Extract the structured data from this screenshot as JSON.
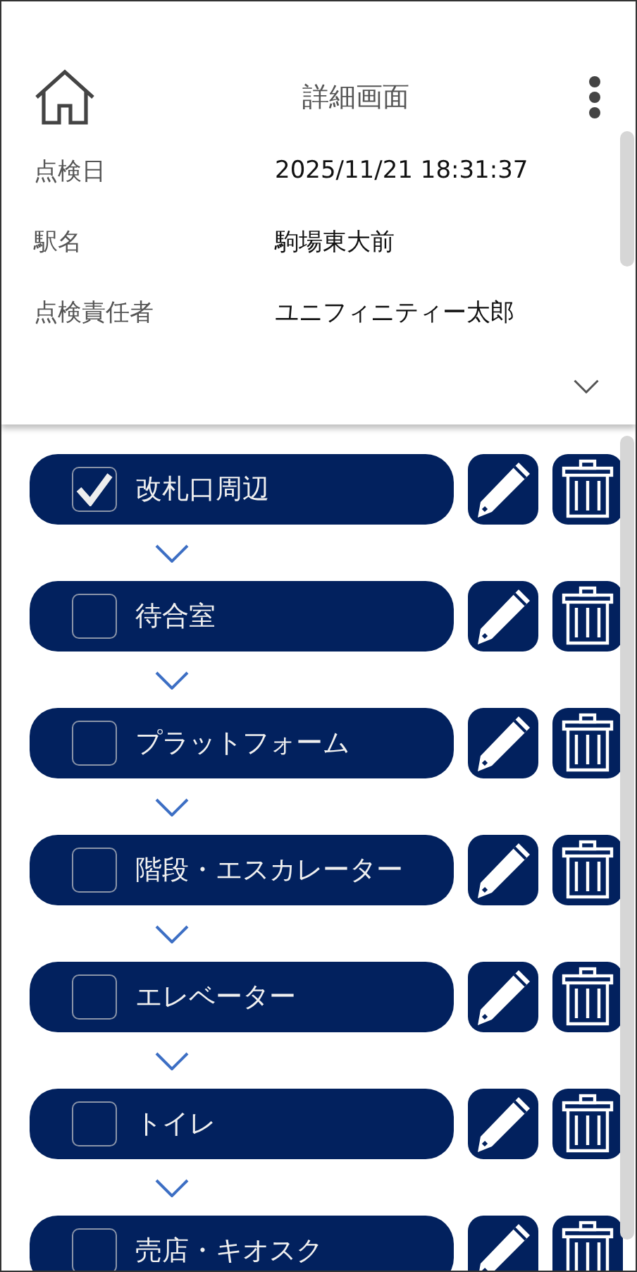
{
  "header": {
    "title": "詳細画面"
  },
  "details": [
    {
      "label": "点検日",
      "value": "2025/11/21 18:31:37"
    },
    {
      "label": "駅名",
      "value": "駒場東大前"
    },
    {
      "label": "点検責任者",
      "value": "ユニフィニティー太郎"
    }
  ],
  "checkpoints": [
    {
      "name": "改札口周辺",
      "checked": true
    },
    {
      "name": "待合室",
      "checked": false
    },
    {
      "name": "プラットフォーム",
      "checked": false
    },
    {
      "name": "階段・エスカレーター",
      "checked": false
    },
    {
      "name": "エレベーター",
      "checked": false
    },
    {
      "name": "トイレ",
      "checked": false
    },
    {
      "name": "売店・キオスク",
      "checked": false
    }
  ]
}
